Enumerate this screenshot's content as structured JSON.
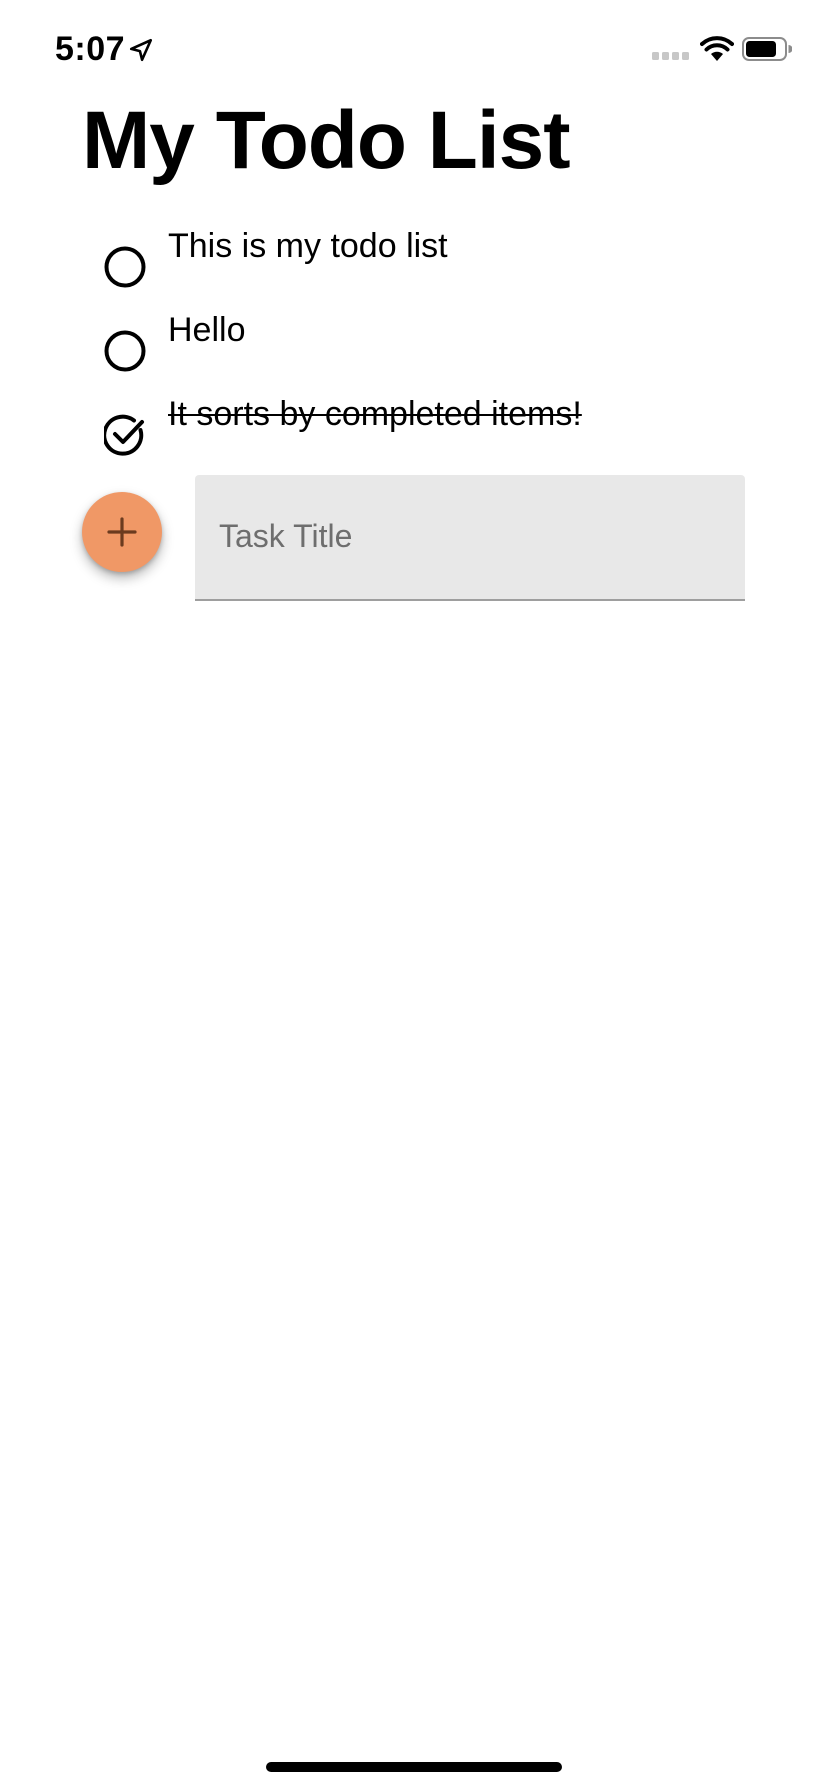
{
  "status_bar": {
    "time": "5:07",
    "location_icon": "location-arrow-icon",
    "signal_icon": "cellular-signal-icon",
    "wifi_icon": "wifi-icon",
    "battery_icon": "battery-icon"
  },
  "header": {
    "title": "My Todo List"
  },
  "todos": [
    {
      "label": "This is my todo list",
      "completed": false,
      "icon": "circle-unchecked-icon"
    },
    {
      "label": "Hello",
      "completed": false,
      "icon": "circle-unchecked-icon"
    },
    {
      "label": "It sorts by completed items!",
      "completed": true,
      "icon": "circle-checked-icon"
    }
  ],
  "add_task": {
    "button_icon": "plus-icon",
    "input_value": "",
    "input_placeholder": "Task Title"
  },
  "colors": {
    "fab": "#f09866",
    "fab_icon": "#6b3b1f",
    "field_background": "#e8e8e8",
    "field_underline": "#9e9e9e",
    "placeholder": "#6e6e6e"
  }
}
